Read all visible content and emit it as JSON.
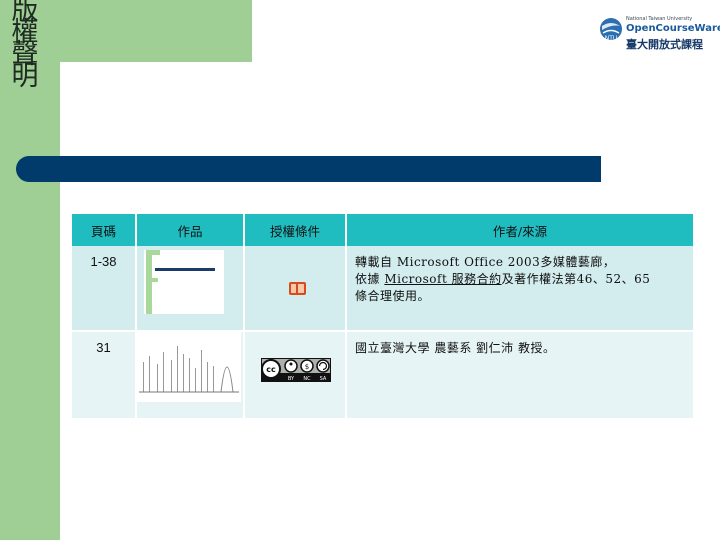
{
  "slide": {
    "title": "版權聲明"
  },
  "logo": {
    "line1": "National Taiwan University",
    "line2": "OpenCourseWare",
    "line3": "臺大開放式課程",
    "badge": "NTU"
  },
  "table": {
    "headers": [
      "頁碼",
      "作品",
      "授權條件",
      "作者/來源"
    ],
    "rows": [
      {
        "page": "1-38",
        "author_pre": "轉載自 Microsoft Office 2003多媒體藝廊，",
        "author_mid_pre": "依據 ",
        "author_link": "Microsoft 服務合約",
        "author_mid_post": "及著作權法第46、52、65",
        "author_post": "條合理使用。"
      },
      {
        "page": "31",
        "author": "國立臺灣大學 農藝系 劉仁沛 教授。",
        "cc_labels": [
          "BY",
          "NC",
          "SA"
        ],
        "cc_text": "cc"
      }
    ]
  },
  "colors": {
    "green": "#9fcf95",
    "navy_bar": "#003b6b",
    "header": "#1fbcc0",
    "row1": "#d3eced",
    "row2": "#e7f4f5"
  }
}
